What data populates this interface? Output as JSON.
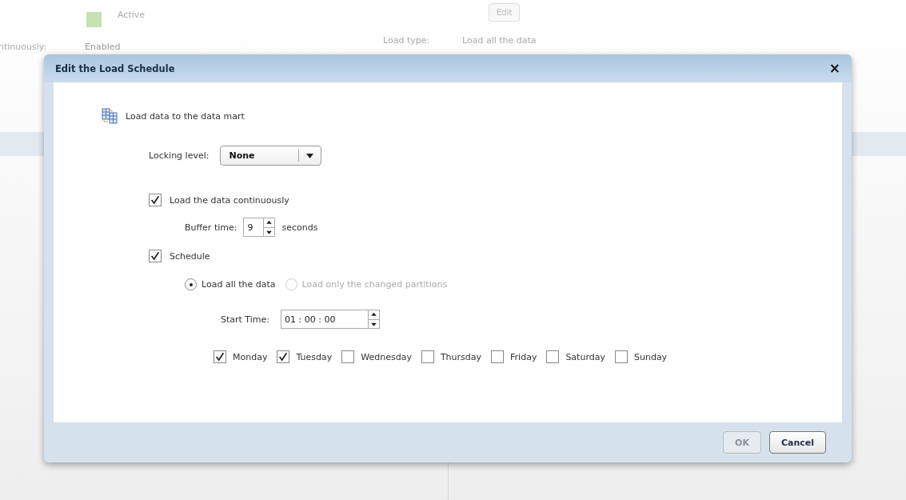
{
  "background": {
    "status_label": "Active",
    "edit_button": "Edit",
    "continuously_label": "ntinuously:",
    "continuously_value": "Enabled",
    "load_type_label": "Load type:",
    "load_type_value": "Load all the data"
  },
  "dialog": {
    "title": "Edit the Load Schedule",
    "close": "×",
    "heading": "Load data to the data mart",
    "locking_level": {
      "label": "Locking level:",
      "value": "None"
    },
    "load_continuously": {
      "label": "Load the data continuously",
      "checked": true
    },
    "buffer_time": {
      "label": "Buffer time:",
      "value": "9",
      "unit": "seconds"
    },
    "schedule": {
      "label": "Schedule",
      "checked": true
    },
    "load_options": [
      {
        "label": "Load all the data",
        "selected": true,
        "disabled": false
      },
      {
        "label": "Load only the changed partitions",
        "selected": false,
        "disabled": true
      }
    ],
    "start_time": {
      "label": "Start Time:",
      "value": "01 : 00 : 00"
    },
    "days": [
      {
        "label": "Monday",
        "checked": true
      },
      {
        "label": "Tuesday",
        "checked": true
      },
      {
        "label": "Wednesday",
        "checked": false
      },
      {
        "label": "Thursday",
        "checked": false
      },
      {
        "label": "Friday",
        "checked": false
      },
      {
        "label": "Saturday",
        "checked": false
      },
      {
        "label": "Sunday",
        "checked": false
      }
    ],
    "buttons": [
      {
        "label": "OK",
        "disabled": true
      },
      {
        "label": "Cancel",
        "disabled": false
      }
    ]
  }
}
